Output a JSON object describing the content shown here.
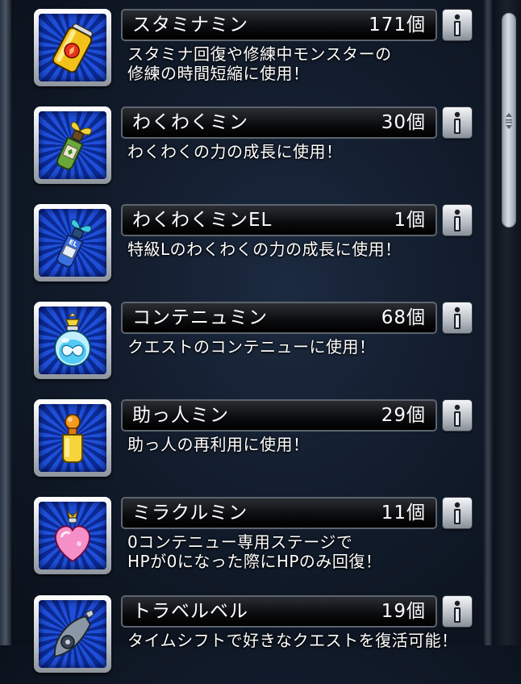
{
  "items": [
    {
      "name": "スタミナミン",
      "count": "171個",
      "icon": "stamina-can-icon",
      "desc": [
        "スタミナ回復や修練中モンスターの",
        "修練の時間短縮に使用！"
      ]
    },
    {
      "name": "わくわくミン",
      "count": "30個",
      "icon": "sprout-bottle-icon",
      "desc": [
        "わくわくの力の成長に使用！"
      ]
    },
    {
      "name": "わくわくミンEL",
      "count": "1個",
      "icon": "sprout-bottle-el-icon",
      "icon_text": "EL",
      "desc": [
        "特級Lのわくわくの力の成長に使用！"
      ]
    },
    {
      "name": "コンテニュミン",
      "count": "68個",
      "icon": "continue-jar-icon",
      "desc": [
        "クエストのコンテニューに使用！"
      ]
    },
    {
      "name": "助っ人ミン",
      "count": "29個",
      "icon": "helper-bottle-icon",
      "desc": [
        "助っ人の再利用に使用！"
      ]
    },
    {
      "name": "ミラクルミン",
      "count": "11個",
      "icon": "miracle-heart-bottle-icon",
      "desc": [
        "0コンテニュー専用ステージで",
        "HPが0になった際にHPのみ回復！"
      ]
    },
    {
      "name": "トラベルベル",
      "count": "19個",
      "icon": "travel-bell-icon",
      "desc": [
        "タイムシフトで好きなクエストを復活可能！"
      ]
    }
  ],
  "colors": {
    "icon_bg_light": "#1f4fd8",
    "icon_bg_dark": "#0b2a94",
    "name_bar": "#000000",
    "text": "#ffffff"
  },
  "info_button_icon": "info-icon"
}
